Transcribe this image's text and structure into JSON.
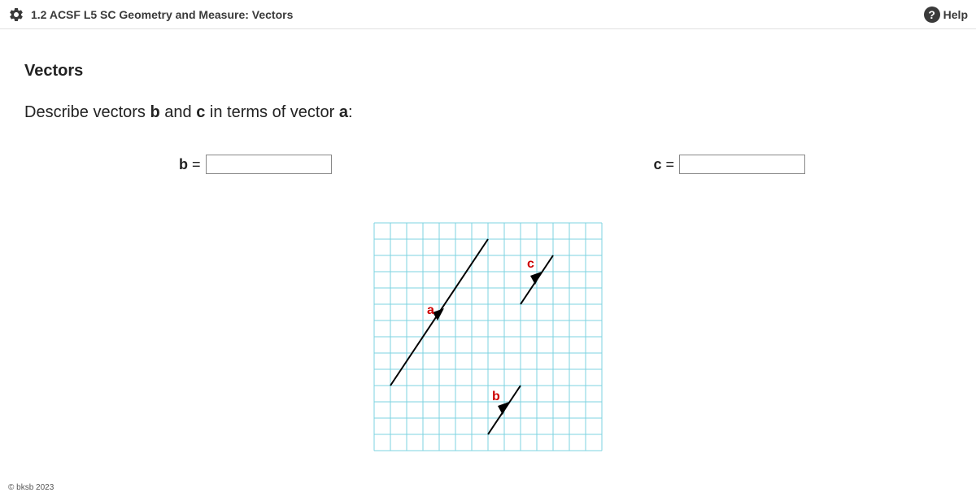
{
  "header": {
    "title": "1.2 ACSF L5 SC Geometry and Measure: Vectors",
    "help": "Help"
  },
  "main": {
    "section_title": "Vectors",
    "question_pre": "Describe vectors ",
    "question_b": "b",
    "question_mid": " and ",
    "question_c": "c",
    "question_post": " in terms of vector ",
    "question_a": "a",
    "question_colon": ":",
    "input_b_var": "b",
    "input_b_eq": " =",
    "input_c_var": "c",
    "input_c_eq": " =",
    "input_b_value": "",
    "input_c_value": ""
  },
  "diagram": {
    "label_a": "a",
    "label_b": "b",
    "label_c": "c"
  },
  "footer": {
    "copyright": "© bksb 2023"
  }
}
